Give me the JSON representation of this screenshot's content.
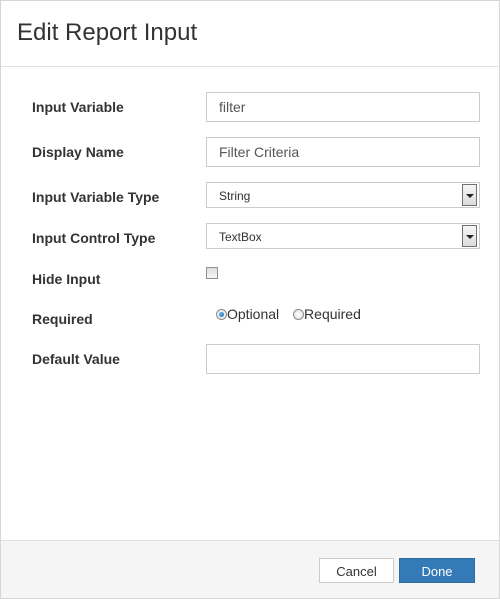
{
  "dialog": {
    "title": "Edit Report Input"
  },
  "form": {
    "input_variable": {
      "label": "Input Variable",
      "value": "filter"
    },
    "display_name": {
      "label": "Display Name",
      "value": "Filter Criteria"
    },
    "input_variable_type": {
      "label": "Input Variable Type",
      "selected": "String"
    },
    "input_control_type": {
      "label": "Input Control Type",
      "selected": "TextBox"
    },
    "hide_input": {
      "label": "Hide Input",
      "checked": false
    },
    "required": {
      "label": "Required",
      "options": [
        {
          "label": "Optional",
          "checked": true
        },
        {
          "label": "Required",
          "checked": false
        }
      ]
    },
    "default_value": {
      "label": "Default Value",
      "value": ""
    }
  },
  "footer": {
    "cancel_label": "Cancel",
    "done_label": "Done"
  },
  "colors": {
    "primary": "#337ab7",
    "footer_bg": "#f5f5f5"
  }
}
